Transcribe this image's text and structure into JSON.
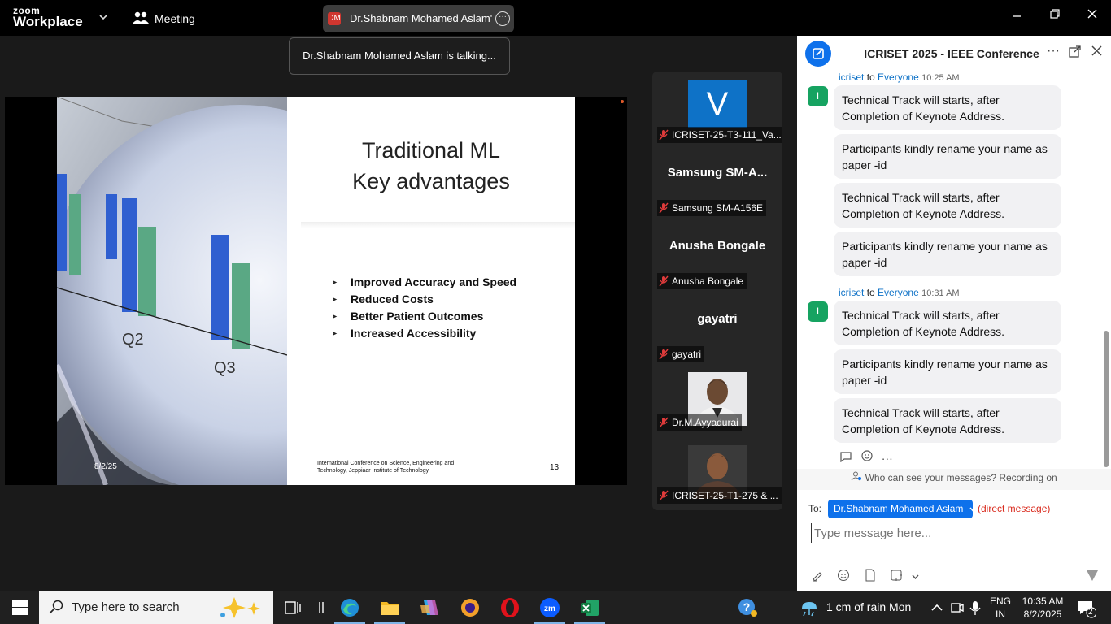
{
  "app": {
    "logo_top": "zoom",
    "logo_bottom": "Workplace",
    "meeting_label": "Meeting",
    "speaker_badge": "DM",
    "speaker_tab": "Dr.Shabnam Mohamed Aslam's screen"
  },
  "toast": "Dr.Shabnam Mohamed Aslam is talking...",
  "slide": {
    "title_line1": "Traditional ML",
    "title_line2": "Key advantages",
    "bullets": [
      "Improved Accuracy and Speed",
      "Reduced Costs",
      "Better Patient Outcomes",
      "Increased Accessibility"
    ],
    "chart_labels": [
      "Q2",
      "Q3"
    ],
    "date": "8/2/25",
    "footer": "International Conference on Science, Engineering and Technology, Jeppiaar Institute of Technology",
    "page_number": "13"
  },
  "participants": [
    {
      "display": "V",
      "label": "ICRISET-25-T3-111_Va..."
    },
    {
      "display": "Samsung  SM-A...",
      "label": "Samsung SM-A156E"
    },
    {
      "display": "Anusha Bongale",
      "label": "Anusha Bongale"
    },
    {
      "display": "gayatri",
      "label": "gayatri"
    },
    {
      "display": "",
      "label": "Dr.M.Ayyadurai"
    },
    {
      "display": "",
      "label": "ICRISET-25-T1-275 & ..."
    }
  ],
  "chat": {
    "title": "ICRISET 2025 - IEEE Conference",
    "groups": [
      {
        "sender": "icriset",
        "to": "to",
        "recipient": "Everyone",
        "time": "10:25 AM",
        "avatar": "I",
        "messages": [
          "Technical Track will starts, after Completion of Keynote Address.",
          "Participants kindly rename your name as paper -id",
          "Technical Track will starts, after Completion of Keynote Address.",
          "Participants kindly rename your name as paper -id"
        ]
      },
      {
        "sender": "icriset",
        "to": "to",
        "recipient": "Everyone",
        "time": "10:31 AM",
        "avatar": "I",
        "messages": [
          "Technical Track will starts, after Completion of Keynote Address.",
          "Participants kindly rename your name as paper -id",
          "Technical Track will starts, after Completion of Keynote Address."
        ]
      }
    ],
    "privacy": "Who can see your messages? Recording on",
    "to_label": "To:",
    "to_recipient": "Dr.Shabnam Mohamed Aslam",
    "direct_note": "(direct message)",
    "placeholder": "Type message here..."
  },
  "taskbar": {
    "search_placeholder": "Type here to search",
    "weather": "1 cm of rain Mon",
    "lang_line1": "ENG",
    "lang_line2": "IN",
    "time": "10:35 AM",
    "date": "8/2/2025",
    "notification_count": "2"
  },
  "colors": {
    "accent": "#0e71eb",
    "chat_avatar": "#16a361",
    "direct_red": "#d9291c"
  }
}
